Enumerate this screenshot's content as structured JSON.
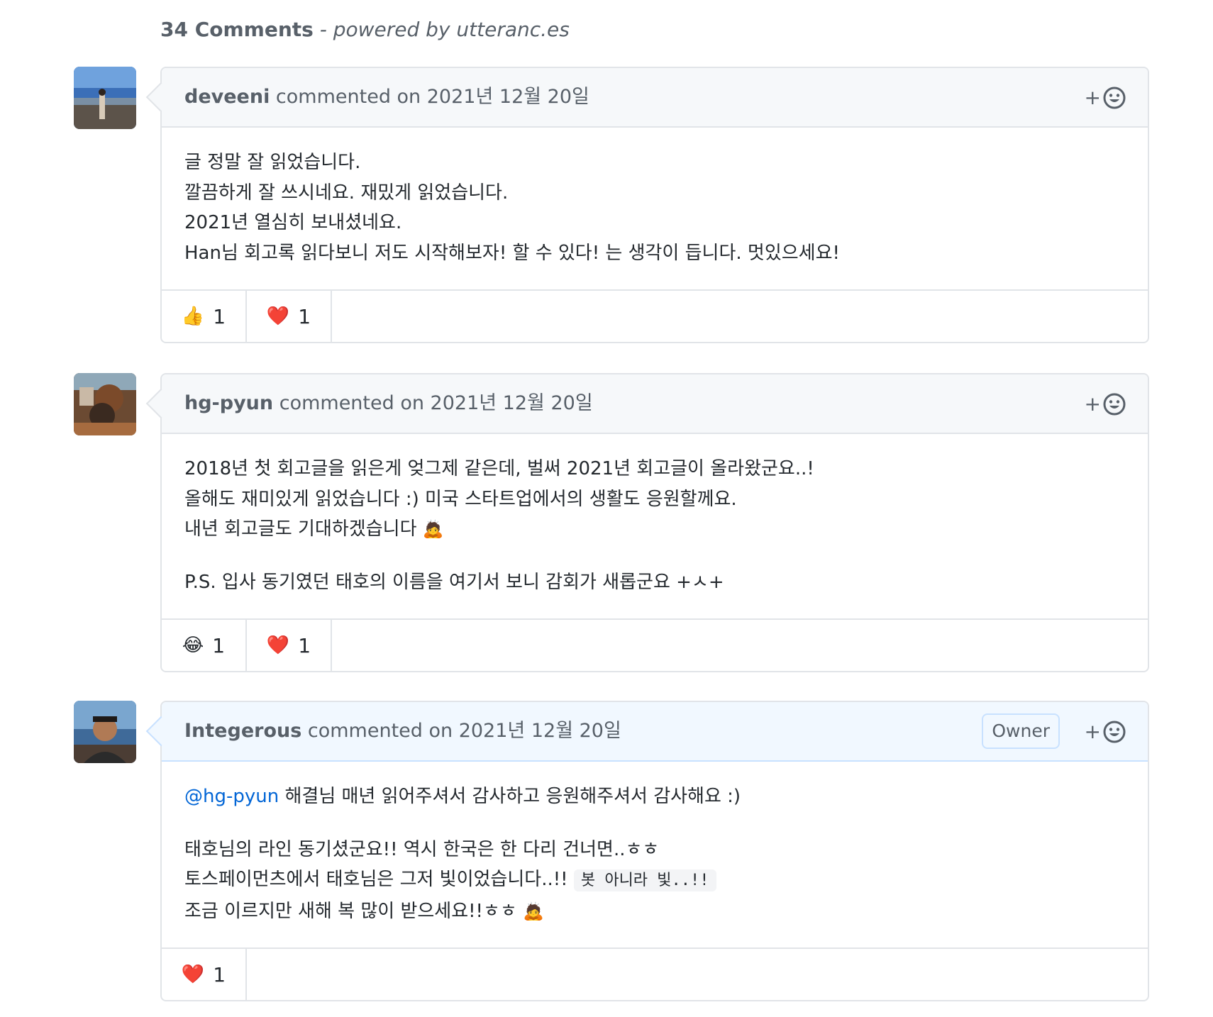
{
  "header": {
    "count": "34 Comments",
    "powered": " - powered by utteranc.es"
  },
  "comments": [
    {
      "author": "deveeni",
      "meta": " commented on 2021년 12월 20일",
      "lines": [
        "글 정말 잘 읽었습니다.",
        "깔끔하게 잘 쓰시네요. 재밌게 읽었습니다.",
        "2021년 열심히 보내셨네요.",
        "Han님 회고록 읽다보니 저도 시작해보자! 할 수 있다! 는 생각이 듭니다. 멋있으세요!"
      ],
      "reactions": [
        {
          "emoji": "👍",
          "count": "1"
        },
        {
          "emoji": "❤️",
          "count": "1"
        }
      ]
    },
    {
      "author": "hg-pyun",
      "meta": " commented on 2021년 12월 20일",
      "lines": [
        "2018년 첫 회고글을 읽은게 엊그제 같은데, 벌써 2021년 회고글이 올라왔군요..!",
        "올해도 재미있게 읽었습니다 :) 미국 스타트업에서의 생활도 응원할께요.",
        "내년 회고글도 기대하겠습니다 ",
        "P.S. 입사 동기였던 태호의 이름을 여기서 보니 감회가 새롭군요 +ㅅ+"
      ],
      "bow_emoji": "🙇",
      "reactions": [
        {
          "emoji": "😂",
          "count": "1"
        },
        {
          "emoji": "❤️",
          "count": "1"
        }
      ]
    },
    {
      "author": "Integerous",
      "meta": " commented on 2021년 12월 20일",
      "badge": "Owner",
      "mention": "@hg-pyun",
      "line1_rest": " 해결님 매년 읽어주셔서 감사하고 응원해주셔서 감사해요 :)",
      "line2": "태호님의 라인 동기셨군요!! 역시 한국은 한 다리 건너면..ㅎㅎ",
      "line3": "토스페이먼츠에서 태호님은 그저 빛이었습니다..!! ",
      "line3_code": "봇 아니라 빛..!!",
      "line4": "조금 이르지만 새해 복 많이 받으세요!!ㅎㅎ ",
      "bow_emoji": "🙇",
      "reactions": [
        {
          "emoji": "❤️",
          "count": "1"
        }
      ]
    }
  ],
  "add_reaction": "+"
}
